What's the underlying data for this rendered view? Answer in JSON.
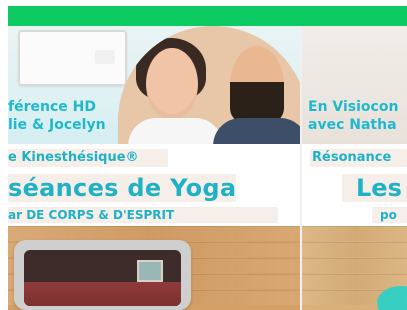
{
  "colors": {
    "top_bar": "#0ccb62",
    "accent_teal": "#1fb1c6",
    "wood": "#d5a067"
  },
  "cards": {
    "left": {
      "banner_lines": [
        "férence HD",
        "lie & Jocelyn"
      ],
      "kicker": "e Kinesthésique®",
      "headline": "séances de Yoga",
      "subline": "ar DE CORPS & D'ESPRIT"
    },
    "right": {
      "banner_lines": [
        "En Visiocon",
        "avec Natha"
      ],
      "kicker": "Résonance",
      "headline": "Les s",
      "subline": "po"
    }
  },
  "icons": {
    "photo": "couple-photo",
    "laptop": "laptop-icon"
  }
}
